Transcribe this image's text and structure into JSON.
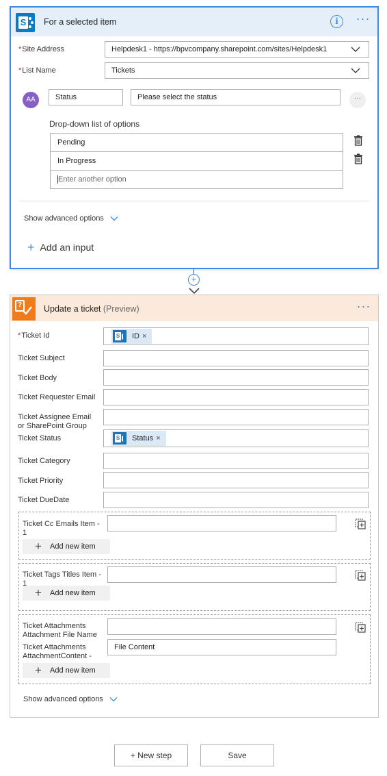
{
  "trigger": {
    "title": "For a selected item",
    "site_address_label": "Site Address",
    "site_address_value": "Helpdesk1 - https://bpvcompany.sharepoint.com/sites/Helpdesk1",
    "list_name_label": "List Name",
    "list_name_value": "Tickets",
    "input": {
      "avatar_text": "AA",
      "name": "Status",
      "description": "Please select the status",
      "more": "···"
    },
    "options_title": "Drop-down list of options",
    "options": [
      "Pending",
      "In Progress"
    ],
    "options_placeholder": "Enter another option",
    "advanced": "Show advanced options",
    "add_input": "Add an input"
  },
  "action": {
    "title": "Update a ticket",
    "preview": "(Preview)",
    "fields": [
      {
        "label": "Ticket Id",
        "required": true
      },
      {
        "label": "Ticket Subject"
      },
      {
        "label": "Ticket Body"
      },
      {
        "label": "Ticket Requester Email"
      },
      {
        "label": "Ticket Assignee Email or SharePoint Group"
      },
      {
        "label": "Ticket Status"
      },
      {
        "label": "Ticket Category"
      },
      {
        "label": "Ticket Priority"
      },
      {
        "label": "Ticket DueDate"
      }
    ],
    "tokens": {
      "id": "ID",
      "status": "Status"
    },
    "cc_group": {
      "label": "Ticket Cc Emails Item - 1",
      "add": "Add new item"
    },
    "tags_group": {
      "label": "Ticket Tags Titles Item - 1",
      "add": "Add new item"
    },
    "attach_group": {
      "label1": "Ticket Attachments Attachment File Name",
      "label2": "Ticket Attachments AttachmentContent -",
      "value2": "File Content",
      "add": "Add new item"
    },
    "advanced": "Show advanced options"
  },
  "footer": {
    "new_step": "+ New step",
    "save": "Save"
  },
  "colors": {
    "accent": "#3c8be0",
    "sharepoint": "#0b7cc3",
    "helpdesk": "#ef7c1c",
    "required": "#c4262e"
  }
}
